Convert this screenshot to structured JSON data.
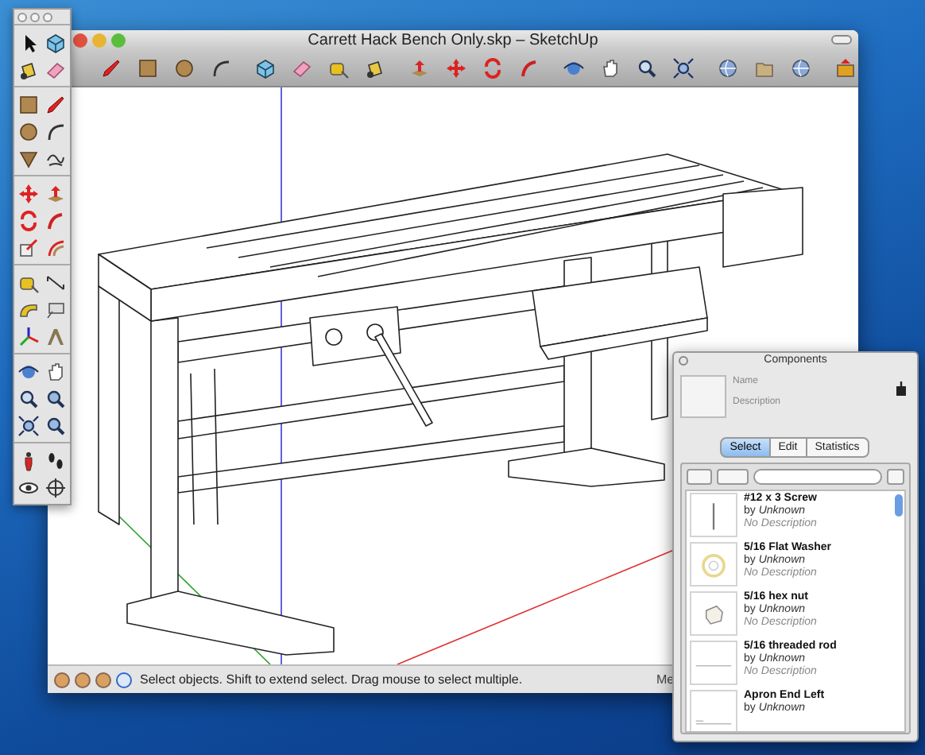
{
  "window": {
    "title": "Carrett Hack Bench Only.skp – SketchUp"
  },
  "status_bar": {
    "message": "Select objects. Shift to extend select. Drag mouse to select multiple.",
    "measurements_label": "Me"
  },
  "components_panel": {
    "title": "Components",
    "name_label": "Name",
    "description_label": "Description",
    "tabs": [
      {
        "label": "Select",
        "selected": true
      },
      {
        "label": "Edit",
        "selected": false
      },
      {
        "label": "Statistics",
        "selected": false
      }
    ],
    "items": [
      {
        "kind": "screw",
        "name": "#12 x 3 Screw",
        "author": "by *Unknown*",
        "description": "No Description"
      },
      {
        "kind": "washer",
        "name": "5/16 Flat Washer",
        "author": "by *Unknown*",
        "description": "No Description"
      },
      {
        "kind": "nut",
        "name": "5/16 hex nut",
        "author": "by *Unknown*",
        "description": "No Description"
      },
      {
        "kind": "rod",
        "name": "5/16 threaded rod",
        "author": "by *Unknown*",
        "description": "No Description"
      },
      {
        "kind": "apron",
        "name": "Apron End Left",
        "author": "by *Unknown*"
      }
    ]
  }
}
